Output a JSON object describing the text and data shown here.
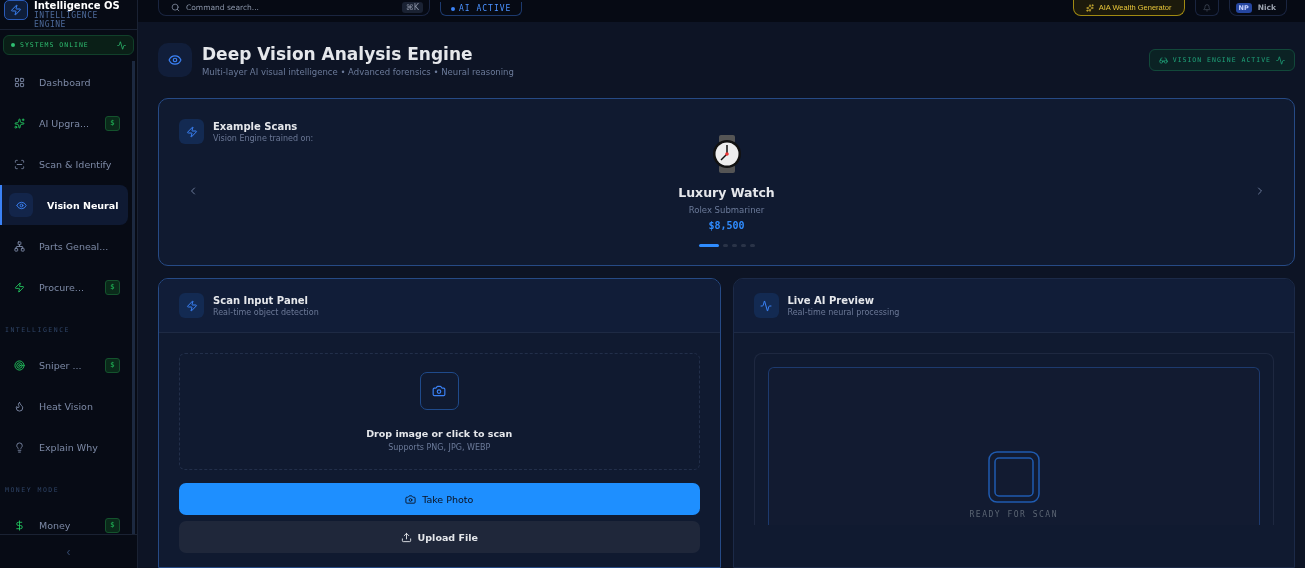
{
  "brand": {
    "title": "Intelligence OS",
    "subtitle": "INTELLIGENCE ENGINE"
  },
  "status": {
    "label": "SYSTEMS ONLINE"
  },
  "nav_groups": [
    {
      "items": [
        {
          "label": "Dashboard",
          "selected": false
        },
        {
          "label": "AI Upgra...",
          "selected": false,
          "badge": "$"
        },
        {
          "label": "Scan & Identify",
          "selected": false
        },
        {
          "label": "Vision Neural",
          "selected": true
        },
        {
          "label": "Parts Geneal...",
          "selected": false
        },
        {
          "label": "Procure...",
          "selected": false,
          "badge": "$"
        }
      ]
    },
    {
      "heading": "INTELLIGENCE",
      "items": [
        {
          "label": "Sniper ...",
          "selected": false,
          "badge": "$"
        },
        {
          "label": "Heat Vision",
          "selected": false
        },
        {
          "label": "Explain Why",
          "selected": false
        }
      ]
    },
    {
      "heading": "MONEY MODE",
      "items": [
        {
          "label": "Money",
          "selected": false,
          "badge": "$"
        }
      ]
    }
  ],
  "collapse": "‹",
  "topbar": {
    "search_placeholder": "Command search...",
    "shortcut": "⌘K",
    "ai_status": "AI ACTIVE",
    "wealth_button": "AIA Wealth Generator",
    "avatar": "NP",
    "user": "Nick"
  },
  "header": {
    "title": "Deep Vision Analysis Engine",
    "subtitle": "Multi-layer AI visual intelligence • Advanced forensics • Neural reasoning",
    "badge": "VISION ENGINE ACTIVE"
  },
  "examples": {
    "title": "Example Scans",
    "subtitle": "Vision Engine trained on:",
    "item": {
      "name": "Luxury Watch",
      "model": "Rolex Submariner",
      "price": "$8,500"
    },
    "dots": [
      {
        "selected": true
      },
      {
        "selected": false
      },
      {
        "selected": false
      },
      {
        "selected": false
      },
      {
        "selected": false
      }
    ]
  },
  "scan_panel": {
    "title": "Scan Input Panel",
    "subtitle": "Real-time object detection",
    "drop_title": "Drop image or click to scan",
    "drop_hint": "Supports PNG, JPG, WEBP",
    "take_photo": "Take Photo",
    "upload": "Upload File"
  },
  "preview_panel": {
    "title": "Live AI Preview",
    "subtitle": "Real-time neural processing",
    "status": "READY FOR SCAN"
  }
}
